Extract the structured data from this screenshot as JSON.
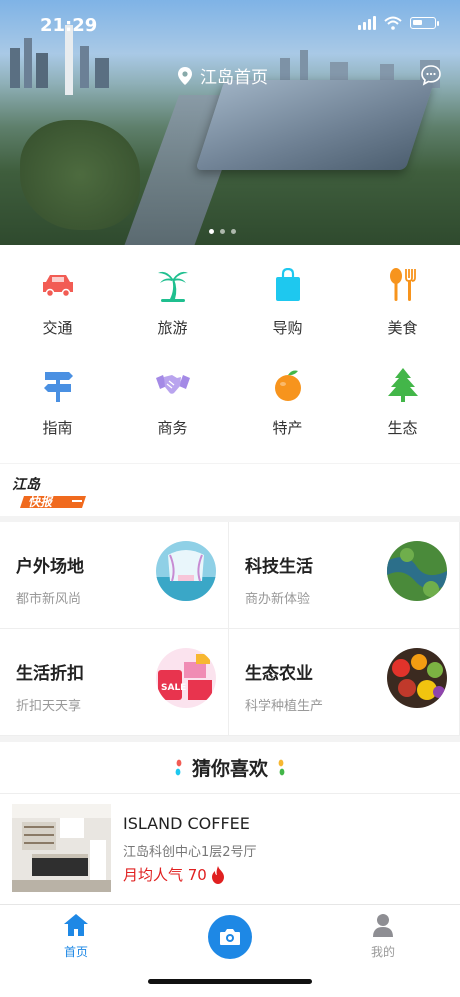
{
  "status": {
    "time": "21:29"
  },
  "header": {
    "location": "江岛首页",
    "location_icon": "location-pin-icon",
    "chat_icon": "message-icon"
  },
  "banner": {
    "slides": 3,
    "active_slide": 1
  },
  "categories": [
    {
      "label": "交通",
      "icon": "car-icon",
      "color": "#f25c54"
    },
    {
      "label": "旅游",
      "icon": "palm-tree-icon",
      "color": "#1fbf8f"
    },
    {
      "label": "导购",
      "icon": "shopping-bag-icon",
      "color": "#1ec8ef"
    },
    {
      "label": "美食",
      "icon": "spoon-fork-icon",
      "color": "#f7941d"
    },
    {
      "label": "指南",
      "icon": "signpost-icon",
      "color": "#4a90e2"
    },
    {
      "label": "商务",
      "icon": "handshake-icon",
      "color": "#a48ae6"
    },
    {
      "label": "特产",
      "icon": "orange-fruit-icon",
      "color": "#f7941d"
    },
    {
      "label": "生态",
      "icon": "pine-tree-icon",
      "color": "#43b649"
    }
  ],
  "news": {
    "logo_text_1": "江岛",
    "logo_text_2": "快报"
  },
  "promos": [
    {
      "title": "户外场地",
      "subtitle": "都市新风尚",
      "image": "outdoor-venue-thumbnail"
    },
    {
      "title": "科技生活",
      "subtitle": "商办新体验",
      "image": "aerial-island-thumbnail"
    },
    {
      "title": "生活折扣",
      "subtitle": "折扣天天享",
      "image": "sale-gifts-thumbnail"
    },
    {
      "title": "生态农业",
      "subtitle": "科学种植生产",
      "image": "fruits-vegetables-thumbnail"
    }
  ],
  "guess": {
    "title": "猜你喜欢"
  },
  "listing": {
    "name": "ISLAND COFFEE",
    "address": "江岛科创中心1层2号厅",
    "popularity": "月均人气 70",
    "icon": "fire-icon"
  },
  "tabbar": {
    "home": "首页",
    "me": "我的",
    "camera_icon": "camera-icon"
  }
}
